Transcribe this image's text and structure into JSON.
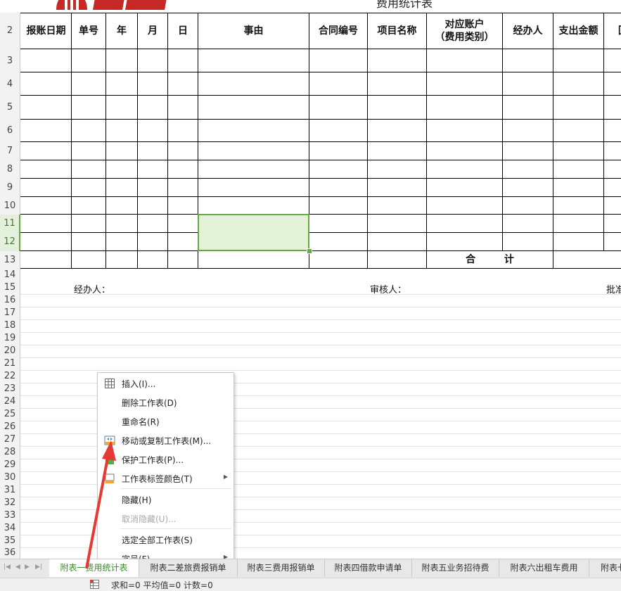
{
  "header": {
    "title_fragment": "费用统计表"
  },
  "rows": {
    "numbers": [
      "2",
      "3",
      "4",
      "5",
      "6",
      "7",
      "8",
      "9",
      "10",
      "11",
      "12",
      "13",
      "14",
      "15",
      "16",
      "17",
      "18",
      "19",
      "20",
      "21",
      "22",
      "23",
      "24",
      "25",
      "26",
      "27",
      "28",
      "29",
      "30",
      "31",
      "32",
      "33",
      "34",
      "35",
      "36"
    ],
    "selected": [
      "11",
      "12"
    ]
  },
  "columns": {
    "headers": [
      "报账日期",
      "单号",
      "年",
      "月",
      "日",
      "事由",
      "合同编号",
      "项目名称",
      "对应账户",
      "（费用类别）",
      "经办人",
      "支出金额",
      "回"
    ]
  },
  "table": {
    "total_label": "合 计"
  },
  "signatures": {
    "handler": "经办人：",
    "reviewer": "审核人：",
    "approver": "批准"
  },
  "selection": {
    "range": "F11:F12",
    "fill": "#e4f3d7",
    "border": "#67a93e"
  },
  "context_menu": {
    "items": [
      {
        "label": "插入(I)...",
        "icon": "insert-table-icon"
      },
      {
        "label": "删除工作表(D)"
      },
      {
        "label": "重命名(R)"
      },
      {
        "label": "移动或复制工作表(M)...",
        "icon": "move-copy-sheet-icon"
      },
      {
        "label": "保护工作表(P)...",
        "icon": "protect-sheet-icon"
      },
      {
        "label": "工作表标签颜色(T)",
        "icon": "tab-color-icon",
        "submenu": true
      },
      {
        "label": "隐藏(H)"
      },
      {
        "label": "取消隐藏(U)...",
        "disabled": true
      },
      {
        "label": "选定全部工作表(S)"
      },
      {
        "label": "字号(F)",
        "submenu": true
      }
    ]
  },
  "sheet_tabs": {
    "tabs": [
      {
        "label": "附表一费用统计表",
        "active": true
      },
      {
        "label": "附表二差旅费报销单"
      },
      {
        "label": "附表三费用报销单"
      },
      {
        "label": "附表四借款申请单"
      },
      {
        "label": "附表五业务招待费"
      },
      {
        "label": "附表六出租车费用"
      },
      {
        "label": "附表七"
      }
    ]
  },
  "status_bar": {
    "text": "求和=0  平均值=0  计数=0"
  },
  "annotation": {
    "arrow_color": "#e53935"
  },
  "colors": {
    "accent": "#67a93e",
    "active_tab_text": "#3c8c2a"
  }
}
